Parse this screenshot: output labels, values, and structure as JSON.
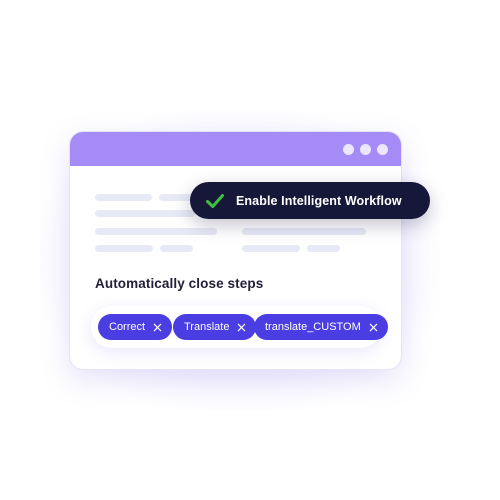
{
  "toast": {
    "message": "Enable Intelligent Workflow",
    "icon": "check-icon"
  },
  "section": {
    "title": "Automatically close steps"
  },
  "chips": [
    {
      "label": "Correct"
    },
    {
      "label": "Translate"
    },
    {
      "label": "translate_CUSTOM"
    }
  ],
  "colors": {
    "titlebar": "#a58bf5",
    "chip": "#4a3ee2",
    "toast": "#16183a",
    "check": "#3fbf3f"
  }
}
